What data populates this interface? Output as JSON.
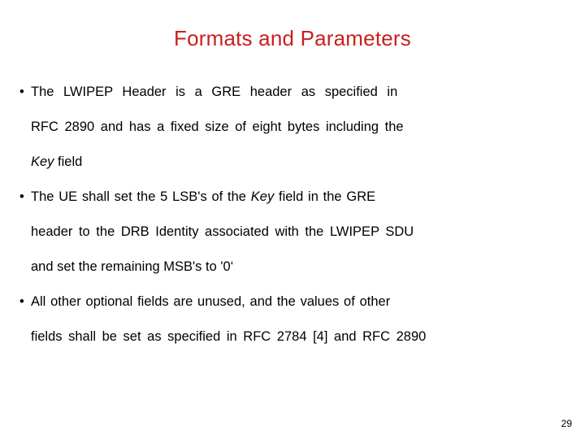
{
  "slide": {
    "title": "Formats and Parameters",
    "title_color": "#C8201E",
    "background_color": "#FFFFFF",
    "text_color": "#000000",
    "page_number": "29",
    "bullet_glyph": "•",
    "bullets": [
      {
        "marker": "•",
        "lines": [
          {
            "text": "The  LWIPEP  Header  is  a  GRE  header  as  specified  in",
            "emphasis": null
          },
          {
            "text": "RFC 2890  and has a fixed size of eight bytes including the",
            "emphasis": null
          },
          {
            "pre": "",
            "emphasis": "Key",
            "post": " field"
          }
        ]
      },
      {
        "marker": "•",
        "lines": [
          {
            "pre": "The  UE  shall  set  the  5  LSB's  of  the  ",
            "emphasis": "Key",
            "post": "  field  in  the  GRE"
          },
          {
            "text": "header to the DRB Identity associated with the LWIPEP SDU",
            "emphasis": null
          },
          {
            "text": "and set the remaining MSB's to '0‘",
            "emphasis": null
          }
        ]
      },
      {
        "marker": "•",
        "lines": [
          {
            "text": "All other optional fields are  unused,  and  the  values  of  other",
            "emphasis": null
          },
          {
            "text": "fields shall be set as specified in RFC 2784 [4] and RFC 2890",
            "emphasis": null
          }
        ]
      }
    ]
  }
}
